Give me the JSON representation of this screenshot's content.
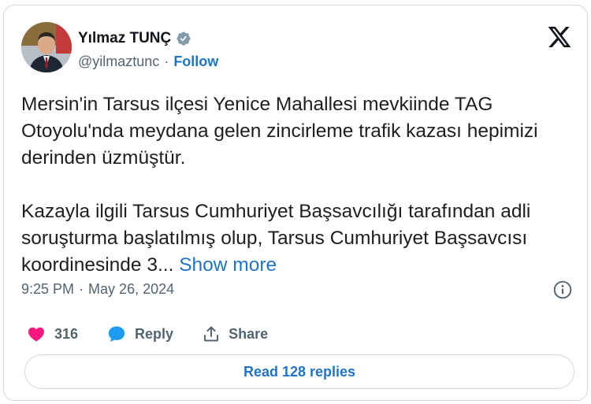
{
  "author": {
    "name": "Yılmaz TUNÇ",
    "handle": "@yilmaztunc",
    "separator": "·",
    "follow_label": "Follow"
  },
  "tweet": {
    "paragraph_1": "Mersin'in Tarsus ilçesi Yenice Mahallesi mevkiinde TAG Otoyolu'nda meydana gelen zincirleme trafik kazası hepimizi derinden üzmüştür.",
    "paragraph_2": "Kazayla ilgili Tarsus Cumhuriyet Başsavcılığı tarafından adli soruşturma başlatılmış olup, Tarsus Cumhuriyet Başsavcısı koordinesinde 3...",
    "show_more_label": "Show more"
  },
  "meta": {
    "time": "9:25 PM",
    "separator": "·",
    "date": "May 26, 2024"
  },
  "actions": {
    "like_count": "316",
    "reply_label": "Reply",
    "share_label": "Share"
  },
  "read_replies_label": "Read 128 replies",
  "colors": {
    "accent": "#1d74c9",
    "like": "#f91880",
    "verified": "#829aab",
    "border": "#cfd9de",
    "muted": "#536471"
  },
  "icons": {
    "verified": "verified-badge-icon",
    "brand": "x-logo-icon",
    "info": "info-icon",
    "like": "heart-icon",
    "reply": "speech-bubble-icon",
    "share": "share-upload-icon"
  }
}
